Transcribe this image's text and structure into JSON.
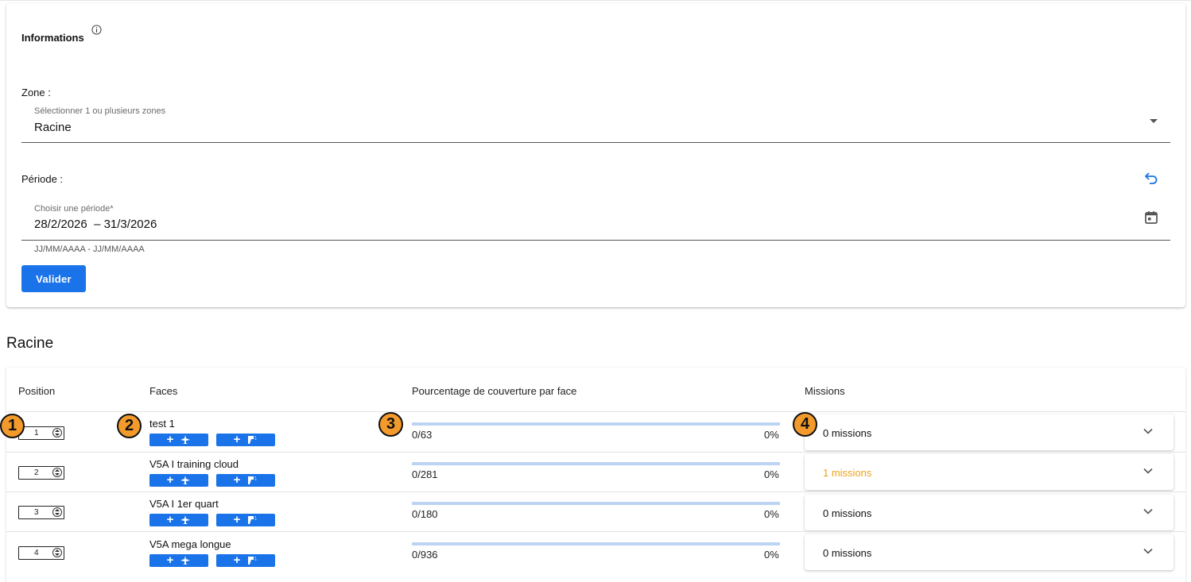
{
  "info_card": {
    "title": "Informations",
    "zone": {
      "label": "Zone :",
      "caption": "Sélectionner 1 ou plusieurs zones",
      "value": "Racine"
    },
    "periode": {
      "label": "Période :",
      "caption": "Choisir une période*",
      "value": "28/2/2026  – 31/3/2026",
      "hint": "JJ/MM/AAAA - JJ/MM/AAAA"
    },
    "submit_label": "Valider"
  },
  "section_title": "Racine",
  "table": {
    "headers": [
      "Position",
      "Faces",
      "Pourcentage de couverture par face",
      "Missions"
    ],
    "rows": [
      {
        "position": "1",
        "face": "test 1",
        "count": "0/63",
        "pct": "0%",
        "missions": "0 missions",
        "missions_highlight": false
      },
      {
        "position": "2",
        "face": "V5A I training cloud",
        "count": "0/281",
        "pct": "0%",
        "missions": "1 missions",
        "missions_highlight": true
      },
      {
        "position": "3",
        "face": "V5A I 1er quart",
        "count": "0/180",
        "pct": "0%",
        "missions": "0 missions",
        "missions_highlight": false
      },
      {
        "position": "4",
        "face": "V5A mega longue",
        "count": "0/936",
        "pct": "0%",
        "missions": "0 missions",
        "missions_highlight": false
      }
    ]
  },
  "callouts": [
    "1",
    "2",
    "3",
    "4"
  ],
  "colors": {
    "primary": "#1a73e8",
    "progress_track": "#bcd3f3",
    "badge": "#f39a2c",
    "mission_highlight": "#f0a21c"
  },
  "icons": {
    "info": "info-icon",
    "reset": "undo-icon",
    "calendar": "calendar-icon",
    "dropdown": "caret-down-icon",
    "expand": "chevron-down-icon",
    "plane": "airplane-icon",
    "drone": "drone-icon"
  }
}
